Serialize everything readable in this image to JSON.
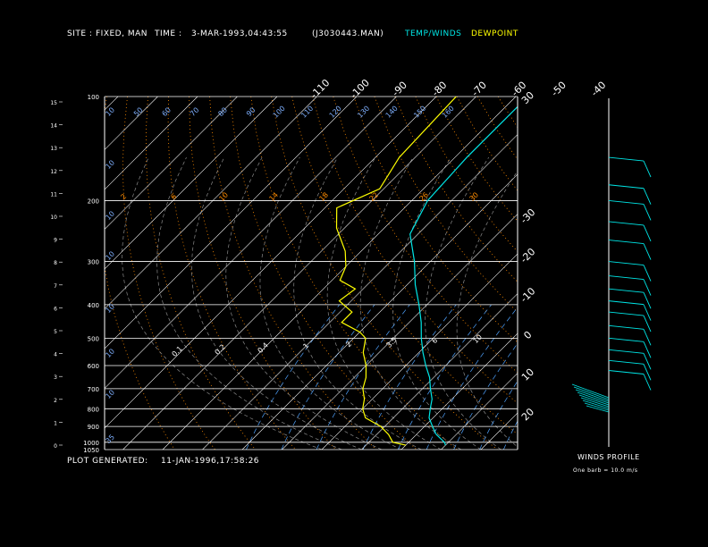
{
  "header": {
    "site_label": "SITE :",
    "site_value": "FIXED, MAN",
    "time_label": "TIME :",
    "time_value": "3-MAR-1993,04:43:55",
    "file_value": "(J3030443.MAN)",
    "temp_legend": "TEMP/WINDS",
    "dew_legend": "DEWPOINT"
  },
  "footer": {
    "generated_label": "PLOT GENERATED:",
    "generated_value": "11-JAN-1996,17:58:26",
    "winds_title": "WINDS PROFILE",
    "winds_note": "One barb = 10.0 m/s"
  },
  "colors": {
    "background": "#000000",
    "grid": "#ffffff",
    "temp": "#00e6e6",
    "dewpoint": "#ffff00",
    "dry_adiabat": "#ff8c00",
    "moist_adiabat": "#8a8a8a",
    "mixing_ratio": "#4fa3ff"
  },
  "chart_data": {
    "type": "line",
    "title": "",
    "pressure_levels": [
      100,
      200,
      300,
      400,
      500,
      600,
      700,
      800,
      900,
      1000,
      1050
    ],
    "height_km_ticks": [
      0,
      1,
      2,
      3,
      4,
      5,
      6,
      7,
      8,
      9,
      10,
      11,
      12,
      13,
      14,
      15
    ],
    "top_temp_ticks": [
      -110,
      -100,
      -90,
      -80,
      -70,
      -60,
      -50,
      -40
    ],
    "right_temp_ticks": [
      -30,
      -20,
      -10,
      0,
      10,
      20,
      30
    ],
    "inner_labels_row1": [
      10,
      50,
      60,
      70,
      80,
      90,
      100,
      110,
      120,
      130,
      140,
      150,
      160
    ],
    "inner_labels_row2": [
      2,
      6,
      10,
      14,
      18,
      22,
      26,
      30
    ],
    "inner_labels_row3": [
      0.1,
      0.2,
      0.4,
      1.0,
      2.0,
      3.5,
      6.0,
      10.0
    ],
    "left_labels": [
      10,
      10,
      10,
      10,
      10,
      10,
      35
    ],
    "series": [
      {
        "name": "TEMP/WINDS",
        "points": [
          [
            100,
            -57
          ],
          [
            150,
            -57
          ],
          [
            200,
            -56
          ],
          [
            250,
            -52
          ],
          [
            300,
            -44
          ],
          [
            350,
            -38
          ],
          [
            400,
            -32
          ],
          [
            450,
            -27
          ],
          [
            500,
            -23
          ],
          [
            550,
            -19
          ],
          [
            600,
            -15
          ],
          [
            650,
            -11
          ],
          [
            700,
            -8
          ],
          [
            750,
            -5
          ],
          [
            800,
            -3
          ],
          [
            850,
            -1
          ],
          [
            900,
            2
          ],
          [
            950,
            5
          ],
          [
            1000,
            9
          ],
          [
            1020,
            10
          ]
        ]
      },
      {
        "name": "DEWPOINT",
        "points": [
          [
            100,
            -75
          ],
          [
            150,
            -74
          ],
          [
            185,
            -71
          ],
          [
            210,
            -77
          ],
          [
            240,
            -72
          ],
          [
            280,
            -64
          ],
          [
            310,
            -60
          ],
          [
            340,
            -58
          ],
          [
            360,
            -52
          ],
          [
            390,
            -53
          ],
          [
            420,
            -47
          ],
          [
            450,
            -47
          ],
          [
            480,
            -40
          ],
          [
            500,
            -37
          ],
          [
            550,
            -34
          ],
          [
            600,
            -30
          ],
          [
            650,
            -27
          ],
          [
            700,
            -25
          ],
          [
            750,
            -22
          ],
          [
            800,
            -20
          ],
          [
            850,
            -17
          ],
          [
            900,
            -11
          ],
          [
            950,
            -7
          ],
          [
            1000,
            -4
          ],
          [
            1020,
            0
          ]
        ]
      }
    ],
    "winds": [
      {
        "p": 150,
        "speed": 20
      },
      {
        "p": 180,
        "speed": 20
      },
      {
        "p": 200,
        "speed": 20
      },
      {
        "p": 230,
        "speed": 20
      },
      {
        "p": 260,
        "speed": 20
      },
      {
        "p": 300,
        "speed": 20
      },
      {
        "p": 330,
        "speed": 20
      },
      {
        "p": 360,
        "speed": 20
      },
      {
        "p": 390,
        "speed": 20
      },
      {
        "p": 420,
        "speed": 20
      },
      {
        "p": 460,
        "speed": 20
      },
      {
        "p": 500,
        "speed": 20
      },
      {
        "p": 540,
        "speed": 20
      },
      {
        "p": 580,
        "speed": 20
      },
      {
        "p": 620,
        "speed": 20
      }
    ]
  }
}
